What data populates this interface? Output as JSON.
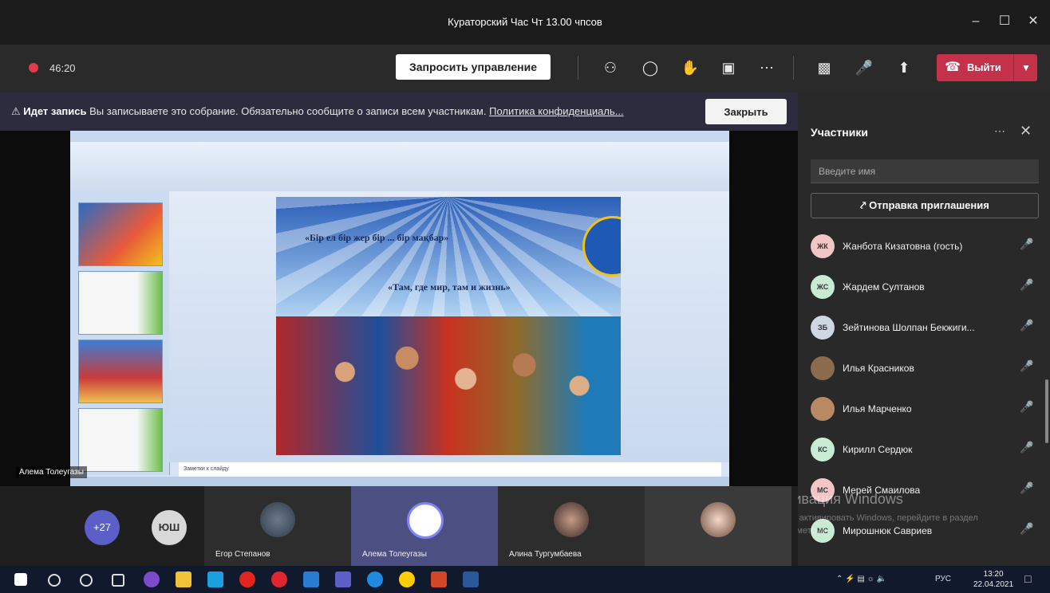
{
  "window": {
    "title": "Кураторский Час Чт 13.00 чпсов",
    "controls": {
      "minimize": "–",
      "maximize": "☐",
      "close": "✕"
    }
  },
  "toolbar": {
    "timer": "46:20",
    "request_control": "Запросить управление",
    "leave_label": "Выйти"
  },
  "banner": {
    "bold": "Идет запись",
    "message": "Вы записываете это собрание. Обязательно сообщите о записи всем участникам.",
    "link": "Политика конфиденциаль...",
    "close_label": "Закрыть"
  },
  "presentation": {
    "notes_placeholder": "Заметки к слайду",
    "slide_text_1": "«Бір ел бір жер бір ... бір мақбар»",
    "slide_text_2": "«Там, где мир, там и жизнь»",
    "presenter_name": "Алема Толеугазы"
  },
  "panel": {
    "title": "Участники",
    "search_placeholder": "Введите имя",
    "invite_label": "Отправка приглашения",
    "participants": [
      {
        "initials": "ЖК",
        "name": "Жанбота Кизатовна (гость)",
        "color": "#f3c6c6"
      },
      {
        "initials": "ЖС",
        "name": "Жардем Султанов",
        "color": "#c8ecd3"
      },
      {
        "initials": "ЗБ",
        "name": "Зейтинова Шолпан Бекжиги...",
        "color": "#cfd7e3"
      },
      {
        "initials": "",
        "name": "Илья Красников",
        "color": "#8a6b4e"
      },
      {
        "initials": "",
        "name": "Илья Марченко",
        "color": "#b88a64"
      },
      {
        "initials": "КС",
        "name": "Кирилл Сердюк",
        "color": "#c8ecd3"
      },
      {
        "initials": "МС",
        "name": "Мерей Смаилова",
        "color": "#f3c6c6"
      },
      {
        "initials": "МС",
        "name": "Мирошнюк Савриев",
        "color": "#c8ecd3"
      }
    ]
  },
  "watermark": {
    "title": "Активация Windows",
    "subtitle": "Чтобы активировать Windows, перейдите в раздел «Параметры»."
  },
  "gallery": {
    "more_count": "+27",
    "ush_initials": "ЮШ",
    "tiles": [
      {
        "name": "Егор Степанов"
      },
      {
        "name": "Алема Толеугазы"
      },
      {
        "name": "Алина Тургумбаева"
      },
      {
        "name": ""
      }
    ]
  },
  "taskbar": {
    "lang": "РУС",
    "time": "13:20",
    "date": "22.04.2021"
  }
}
